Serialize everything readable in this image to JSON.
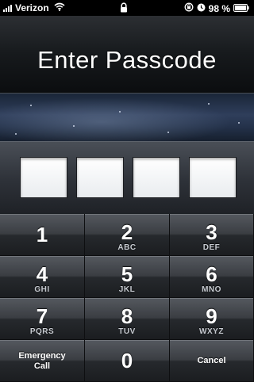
{
  "status_bar": {
    "carrier": "Verizon",
    "battery": "98 %",
    "signal_icon": "signal-bars-icon",
    "wifi_icon": "wifi-icon",
    "lock_icon": "lock-icon",
    "rotation_lock_icon": "rotation-lock-icon",
    "alarm_icon": "alarm-icon",
    "battery_icon": "battery-icon"
  },
  "header": {
    "title": "Enter Passcode"
  },
  "passcode": {
    "digits_entered": 0,
    "box_count": 4
  },
  "keypad": {
    "keys": [
      {
        "digit": "1",
        "letters": ""
      },
      {
        "digit": "2",
        "letters": "ABC"
      },
      {
        "digit": "3",
        "letters": "DEF"
      },
      {
        "digit": "4",
        "letters": "GHI"
      },
      {
        "digit": "5",
        "letters": "JKL"
      },
      {
        "digit": "6",
        "letters": "MNO"
      },
      {
        "digit": "7",
        "letters": "PQRS"
      },
      {
        "digit": "8",
        "letters": "TUV"
      },
      {
        "digit": "9",
        "letters": "WXYZ"
      }
    ],
    "emergency_label_line1": "Emergency",
    "emergency_label_line2": "Call",
    "zero": "0",
    "cancel_label": "Cancel"
  },
  "colors": {
    "keypad_text": "#ffffff",
    "letters_text": "#c7cbd1",
    "box_fill": "#ffffff"
  }
}
